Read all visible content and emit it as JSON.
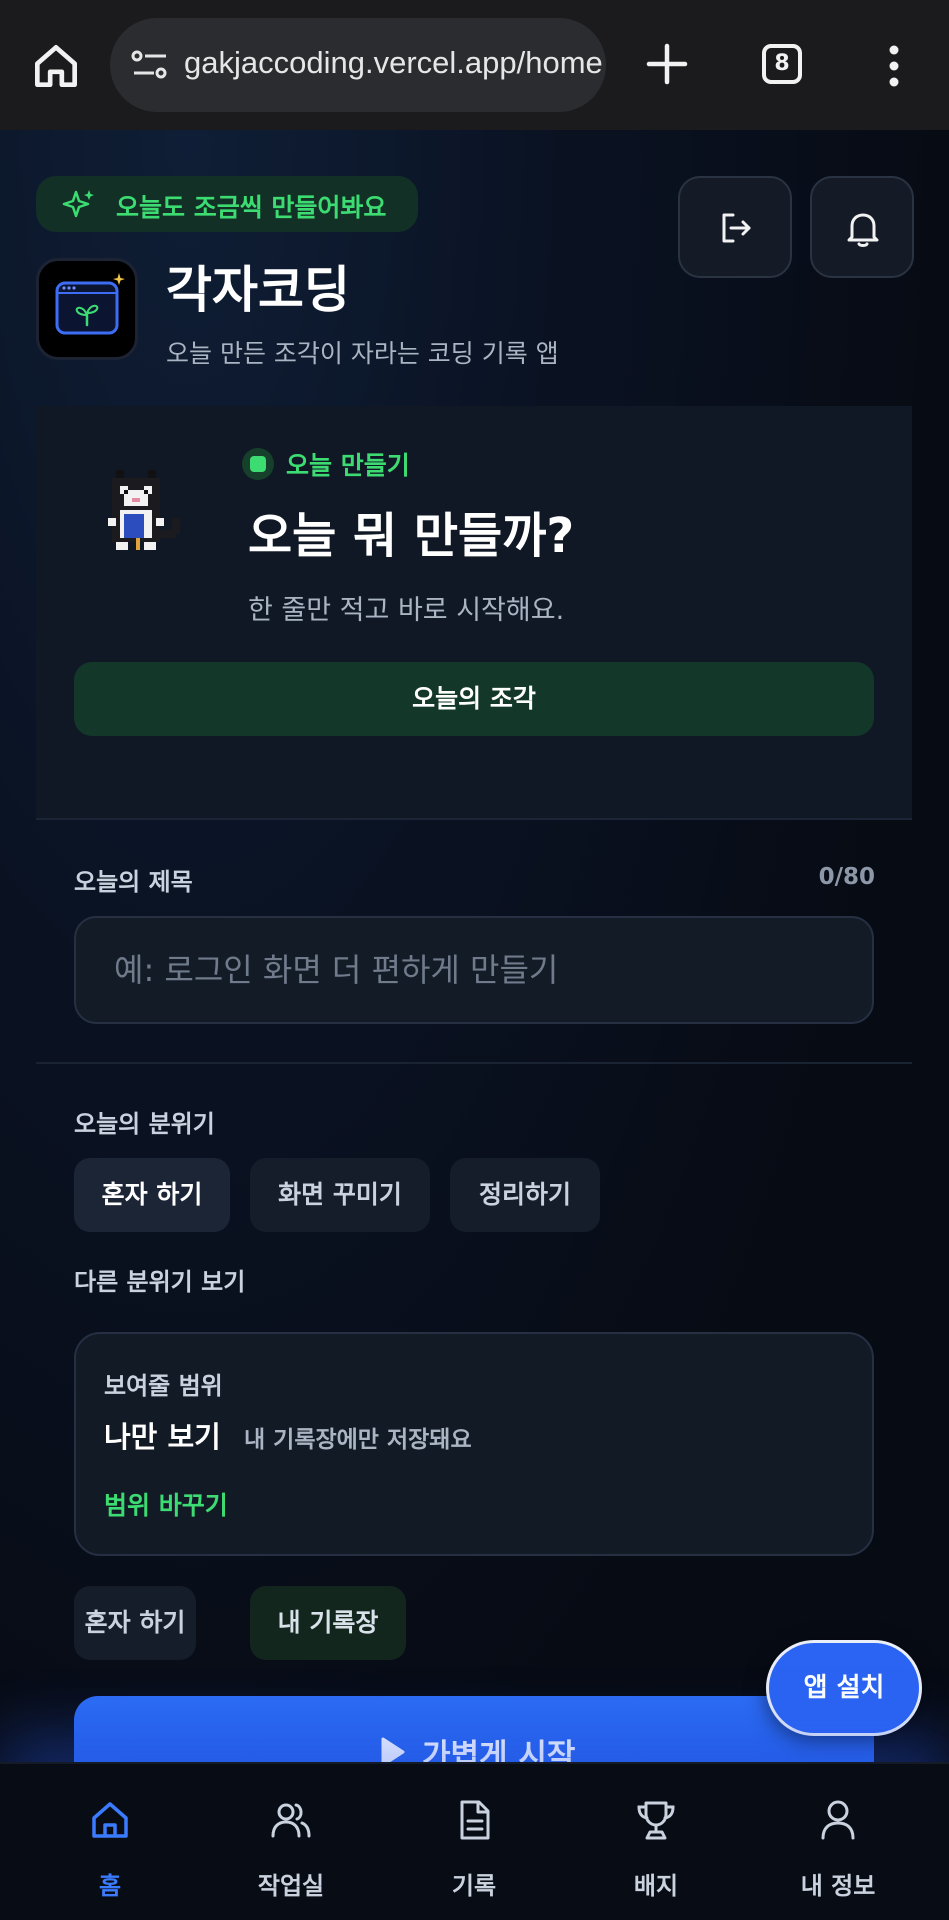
{
  "browser": {
    "url": "gakjaccoding.vercel.app/home",
    "tab_count": "8"
  },
  "header": {
    "tagline": "오늘도 조금씩 만들어봐요",
    "app_title": "각자코딩",
    "app_subtitle": "오늘 만든 조각이 자라는 코딩 기록 앱"
  },
  "hero": {
    "pill": "오늘 만들기",
    "heading": "오늘 뭐 만들까?",
    "subtext": "한 줄만 적고 바로 시작해요.",
    "cta": "오늘의 조각"
  },
  "title_field": {
    "label": "오늘의 제목",
    "counter": "0/80",
    "placeholder": "예: 로그인 화면 더 편하게 만들기",
    "value": ""
  },
  "mood": {
    "label": "오늘의 분위기",
    "options": [
      "혼자 하기",
      "화면 꾸미기",
      "정리하기"
    ],
    "selected": "혼자 하기",
    "more_label": "다른 분위기 보기"
  },
  "scope": {
    "caption": "보여줄 범위",
    "value": "나만 보기",
    "note": "내 기록장에만 저장돼요",
    "change": "범위 바꾸기"
  },
  "summary_chips": [
    "혼자 하기",
    "내 기록장"
  ],
  "start_button": "가볍게 시작",
  "install_button": "앱 설치",
  "nav": {
    "items": [
      {
        "label": "홈",
        "icon": "home-icon",
        "active": true
      },
      {
        "label": "작업실",
        "icon": "users-icon",
        "active": false
      },
      {
        "label": "기록",
        "icon": "document-icon",
        "active": false
      },
      {
        "label": "배지",
        "icon": "trophy-icon",
        "active": false
      },
      {
        "label": "내 정보",
        "icon": "user-icon",
        "active": false
      }
    ]
  },
  "colors": {
    "accent_green": "#3ddc72",
    "accent_blue": "#2b64f2",
    "background": "#070b14"
  }
}
